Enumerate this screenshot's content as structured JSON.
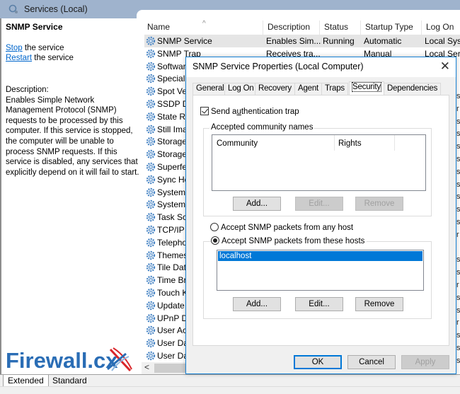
{
  "header": {
    "title": "Services (Local)",
    "icon": "services-gear-icon"
  },
  "left_pane": {
    "service_name": "SNMP Service",
    "actions": [
      {
        "link": "Stop",
        "rest": " the service"
      },
      {
        "link": "Restart",
        "rest": " the service"
      }
    ],
    "description_label": "Description:",
    "description": "Enables Simple Network Management Protocol (SNMP) requests to be processed by this computer. If this service is stopped, the computer will be unable to process SNMP requests. If this service is disabled, any services that explicitly depend on it will fail to start.",
    "logo_text": "Firewall.cx"
  },
  "list": {
    "columns": [
      "Name",
      "Description",
      "Status",
      "Startup Type",
      "Log On As"
    ],
    "rows": [
      {
        "name": "SNMP Service",
        "description": "Enables Sim...",
        "status": "Running",
        "startup": "Automatic",
        "logon": "Local Sys"
      },
      {
        "name": "SNMP Trap",
        "description": "Receives tra...",
        "status": "",
        "startup": "Manual",
        "logon": "Local Ser"
      },
      {
        "name": "Software"
      },
      {
        "name": "Special"
      },
      {
        "name": "Spot Ver"
      },
      {
        "name": "SSDP Di"
      },
      {
        "name": "State Re"
      },
      {
        "name": "Still Ima"
      },
      {
        "name": "Storage"
      },
      {
        "name": "Storage"
      },
      {
        "name": "Superfet"
      },
      {
        "name": "Sync Hc"
      },
      {
        "name": "System"
      },
      {
        "name": "System"
      },
      {
        "name": "Task Sch"
      },
      {
        "name": "TCP/IP N"
      },
      {
        "name": "Telepho"
      },
      {
        "name": "Themes"
      },
      {
        "name": "Tile Data"
      },
      {
        "name": "Time Br"
      },
      {
        "name": "Touch K"
      },
      {
        "name": "Update"
      },
      {
        "name": "UPnP De"
      },
      {
        "name": "User Acc"
      },
      {
        "name": "User Dat"
      },
      {
        "name": "User Dat"
      }
    ],
    "right_edge_letters": [
      "s",
      "r",
      "s",
      "s",
      "s",
      "s",
      "s",
      "s",
      "s",
      "s",
      "s",
      "r",
      "",
      "s",
      "s",
      "r",
      "s",
      "s",
      "r",
      "s",
      "s",
      "s"
    ]
  },
  "bottom_tabs": [
    "Extended",
    "Standard"
  ],
  "dialog": {
    "title": "SNMP Service Properties (Local Computer)",
    "tabs": [
      "General",
      "Log On",
      "Recovery",
      "Agent",
      "Traps",
      "Security",
      "Dependencies"
    ],
    "active_tab": "Security",
    "send_auth_trap": {
      "label_pre": "Send a",
      "label_u": "u",
      "label_post": "thentication trap",
      "checked": true
    },
    "community": {
      "group_label": "Accepted community names",
      "columns": [
        "Community",
        "Rights"
      ],
      "items": [],
      "buttons": [
        {
          "label": "Add...",
          "disabled": false
        },
        {
          "label": "Edit...",
          "disabled": true
        },
        {
          "label": "Remove",
          "disabled": true
        }
      ]
    },
    "accept_any_host": {
      "label": "Accept SNMP packets from any host",
      "selected": false
    },
    "accept_these_hosts": {
      "label": "Accept SNMP packets from these hosts",
      "selected": true
    },
    "hosts": {
      "items": [
        "localhost"
      ],
      "buttons": [
        {
          "label": "Add...",
          "disabled": false
        },
        {
          "label": "Edit...",
          "disabled": false
        },
        {
          "label": "Remove",
          "disabled": false
        }
      ]
    },
    "footer_buttons": [
      {
        "label": "OK",
        "disabled": false,
        "default": true
      },
      {
        "label": "Cancel",
        "disabled": false
      },
      {
        "label": "Apply",
        "disabled": true
      }
    ]
  },
  "colors": {
    "header_bg": "#9fb3cd",
    "link": "#0066cc",
    "selection": "#0078d7",
    "dialog_border": "#1883d7",
    "logo_blue": "#2a6db5",
    "logo_red": "#d9262b"
  }
}
